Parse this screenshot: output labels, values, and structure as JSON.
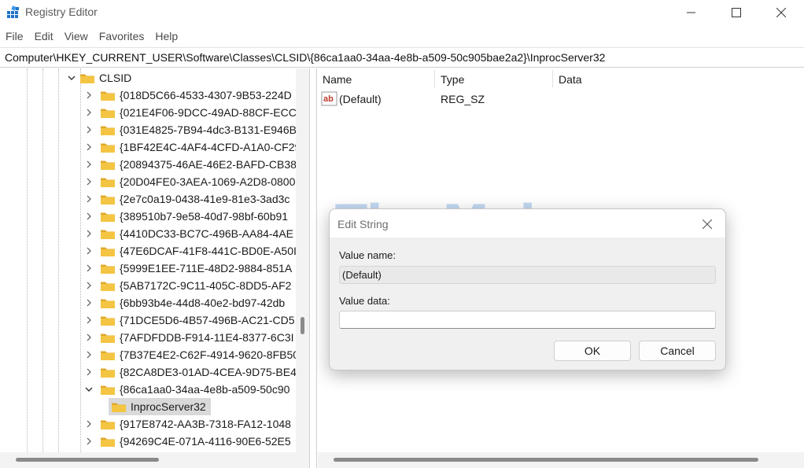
{
  "window": {
    "title": "Registry Editor",
    "controls": {
      "minimize": "minimize-icon",
      "maximize": "maximize-icon",
      "close": "close-icon"
    }
  },
  "menu": [
    "File",
    "Edit",
    "View",
    "Favorites",
    "Help"
  ],
  "address": "Computer\\HKEY_CURRENT_USER\\Software\\Classes\\CLSID\\{86ca1aa0-34aa-4e8b-a509-50c905bae2a2}\\InprocServer32",
  "tree": {
    "root": {
      "label": "CLSID",
      "expanded": true
    },
    "items": [
      {
        "label": "{018D5C66-4533-4307-9B53-224D",
        "expanded": false
      },
      {
        "label": "{021E4F06-9DCC-49AD-88CF-ECC2",
        "expanded": false
      },
      {
        "label": "{031E4825-7B94-4dc3-B131-E946B",
        "expanded": false
      },
      {
        "label": "{1BF42E4C-4AF4-4CFD-A1A0-CF29",
        "expanded": false
      },
      {
        "label": "{20894375-46AE-46E2-BAFD-CB38",
        "expanded": false
      },
      {
        "label": "{20D04FE0-3AEA-1069-A2D8-0800",
        "expanded": false
      },
      {
        "label": "{2e7c0a19-0438-41e9-81e3-3ad3c",
        "expanded": false
      },
      {
        "label": "{389510b7-9e58-40d7-98bf-60b91",
        "expanded": false
      },
      {
        "label": "{4410DC33-BC7C-496B-AA84-4AE",
        "expanded": false
      },
      {
        "label": "{47E6DCAF-41F8-441C-BD0E-A50I",
        "expanded": false
      },
      {
        "label": "{5999E1EE-711E-48D2-9884-851A",
        "expanded": false
      },
      {
        "label": "{5AB7172C-9C11-405C-8DD5-AF2",
        "expanded": false
      },
      {
        "label": "{6bb93b4e-44d8-40e2-bd97-42db",
        "expanded": false
      },
      {
        "label": "{71DCE5D6-4B57-496B-AC21-CD5",
        "expanded": false
      },
      {
        "label": "{7AFDFDDB-F914-11E4-8377-6C3I",
        "expanded": false
      },
      {
        "label": "{7B37E4E2-C62F-4914-9620-8FB50",
        "expanded": false
      },
      {
        "label": "{82CA8DE3-01AD-4CEA-9D75-BE4",
        "expanded": false
      },
      {
        "label": "{86ca1aa0-34aa-4e8b-a509-50c90",
        "expanded": true
      },
      {
        "label": "{917E8742-AA3B-7318-FA12-1048",
        "expanded": false
      },
      {
        "label": "{94269C4E-071A-4116-90E6-52E5",
        "expanded": false
      }
    ],
    "child": {
      "label": "InprocServer32",
      "selected": true
    }
  },
  "list": {
    "columns": [
      "Name",
      "Type",
      "Data"
    ],
    "rows": [
      {
        "name": "(Default)",
        "type": "REG_SZ",
        "data": "",
        "icon": "string-value-icon"
      }
    ]
  },
  "dialog": {
    "title": "Edit String",
    "value_name_label": "Value name:",
    "value_name": "(Default)",
    "value_data_label": "Value data:",
    "value_data": "",
    "ok_label": "OK",
    "cancel_label": "Cancel"
  },
  "watermark": {
    "text": "TipsMake",
    "suffix": ".com"
  },
  "colors": {
    "folder": "#f4c542",
    "folder_dark": "#e0a92a",
    "selection": "#d9d9d9",
    "dialog_bg": "#f0f0f0",
    "scroll_thumb": "#8a8a8a"
  }
}
